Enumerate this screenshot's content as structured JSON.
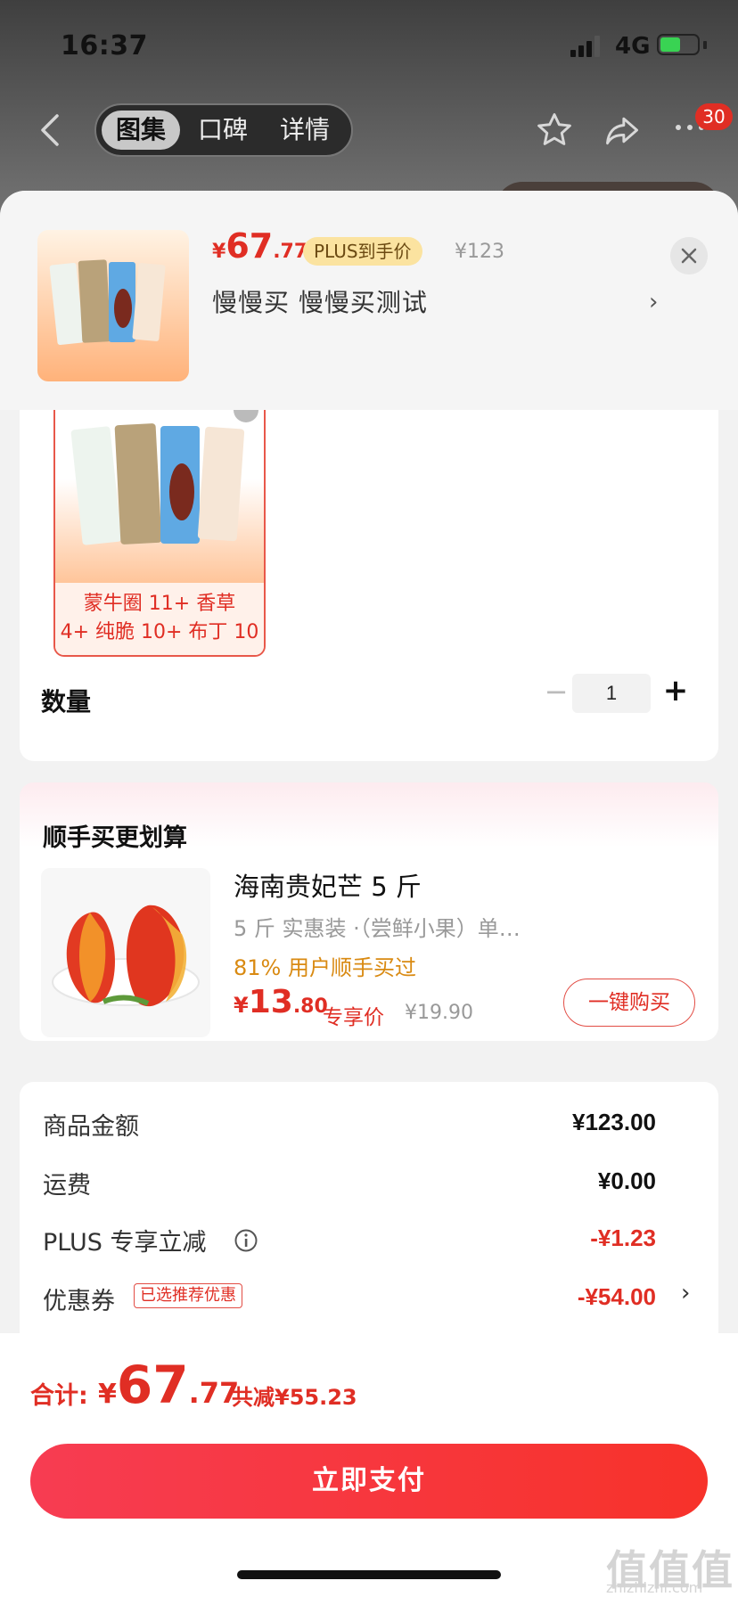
{
  "status_bar": {
    "time": "16:37",
    "network": "4G"
  },
  "nav": {
    "tabs": [
      {
        "label": "图集",
        "active": true
      },
      {
        "label": "口碑",
        "active": false
      },
      {
        "label": "详情",
        "active": false
      }
    ],
    "badge": "30"
  },
  "sheet_header": {
    "currency": "¥",
    "price_int": "67",
    "price_dec": ".77",
    "plus_tag": "PLUS到手价",
    "original_price": "¥123",
    "sku_text": "慢慢买  慢慢买测试"
  },
  "sku_option": {
    "caption_line1": "蒙牛圈 11+ 香草",
    "caption_line2": "4+ 纯脆 10+ 布丁 10"
  },
  "quantity": {
    "label": "数量",
    "minus": "−",
    "value": "1",
    "plus": "+"
  },
  "recommend": {
    "title": "顺手买更划算",
    "item_title": "海南贵妃芒 5 斤",
    "item_spec": "5 斤  实惠装  ·（尝鲜小果）单…",
    "item_percent": "81% 用户顺手买过",
    "price_currency": "¥",
    "price_int": "13",
    "price_dec": ".80",
    "exclusive_label": "专享价",
    "original_price": "¥19.90",
    "buy_button": "一键购买"
  },
  "summary": {
    "rows": [
      {
        "label": "商品金额",
        "value": "¥123.00"
      },
      {
        "label": "运费",
        "value": "¥0.00"
      },
      {
        "label": "PLUS 专享立减",
        "value": "-¥1.23"
      },
      {
        "label": "优惠券",
        "value": "-¥54.00",
        "tag": "已选推荐优惠"
      }
    ]
  },
  "footer": {
    "total_label": "合计:",
    "currency": "¥",
    "total_int": "67",
    "total_dec": ".77",
    "saved": "共减¥55.23",
    "pay_button": "立即支付"
  },
  "watermark": {
    "text": "值值值",
    "sub": "zhizhizhi.com"
  },
  "colors": {
    "accent": "#e02e24",
    "plus_tag_bg": "#fbe3a0",
    "badge": "#e02e24"
  }
}
